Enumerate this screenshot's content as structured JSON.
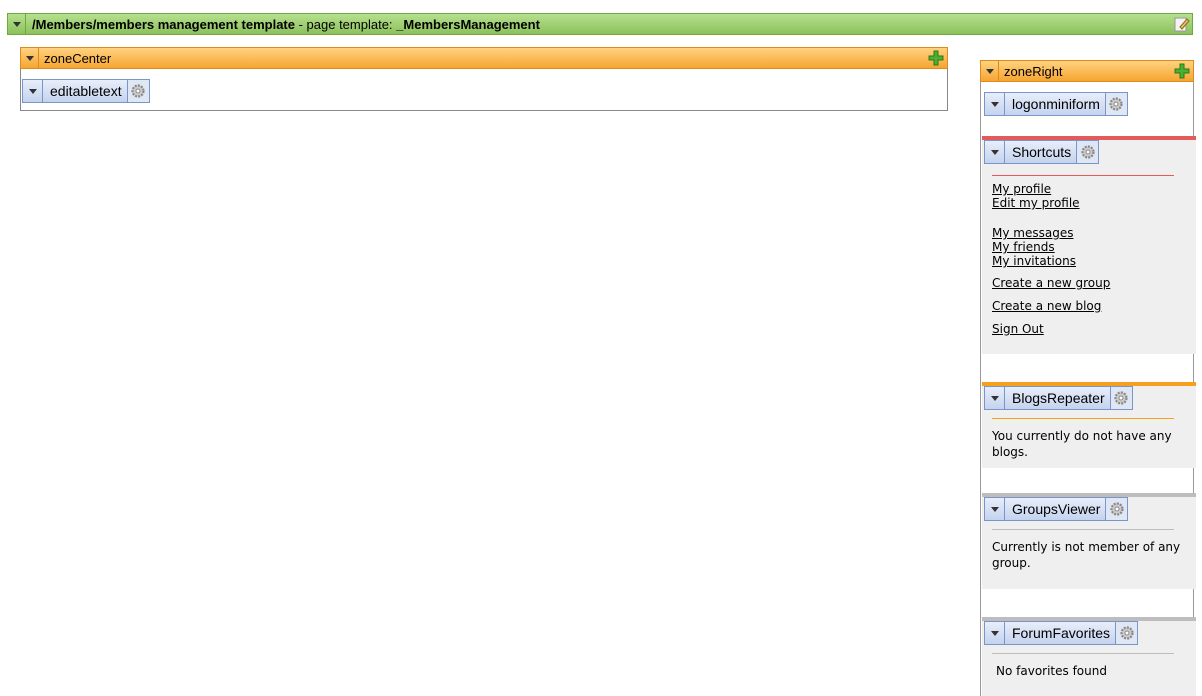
{
  "template_bar": {
    "path": "/Members/members management template",
    "separator": " - page template: ",
    "template_name": "_MembersManagement"
  },
  "zone_center": {
    "label": "zoneCenter",
    "webparts": [
      {
        "label": "editabletext"
      }
    ]
  },
  "zone_right": {
    "label": "zoneRight",
    "logon": {
      "label": "logonminiform"
    },
    "shortcuts": {
      "label": "Shortcuts",
      "links": [
        "My profile",
        "Edit my profile",
        "My messages",
        "My friends",
        "My invitations",
        "Create a new group",
        "Create a new blog",
        "Sign Out"
      ]
    },
    "blogs": {
      "label": "BlogsRepeater",
      "message": "You currently do not have any blogs."
    },
    "groups": {
      "label": "GroupsViewer",
      "message": "Currently is not member of any group."
    },
    "forums": {
      "label": "ForumFavorites",
      "message": "No favorites found"
    }
  },
  "colors": {
    "template_bar": "#8cc15c",
    "zone_header": "#f6a532",
    "webpart_chip": "#c4d3ee",
    "shortcuts_accent": "#e25a5a",
    "blogs_accent": "#f6a020",
    "groups_accent": "#bdbdbd"
  },
  "icons": [
    "collapse-arrow-icon",
    "edit-template-icon",
    "add-webpart-icon",
    "gear-icon"
  ]
}
